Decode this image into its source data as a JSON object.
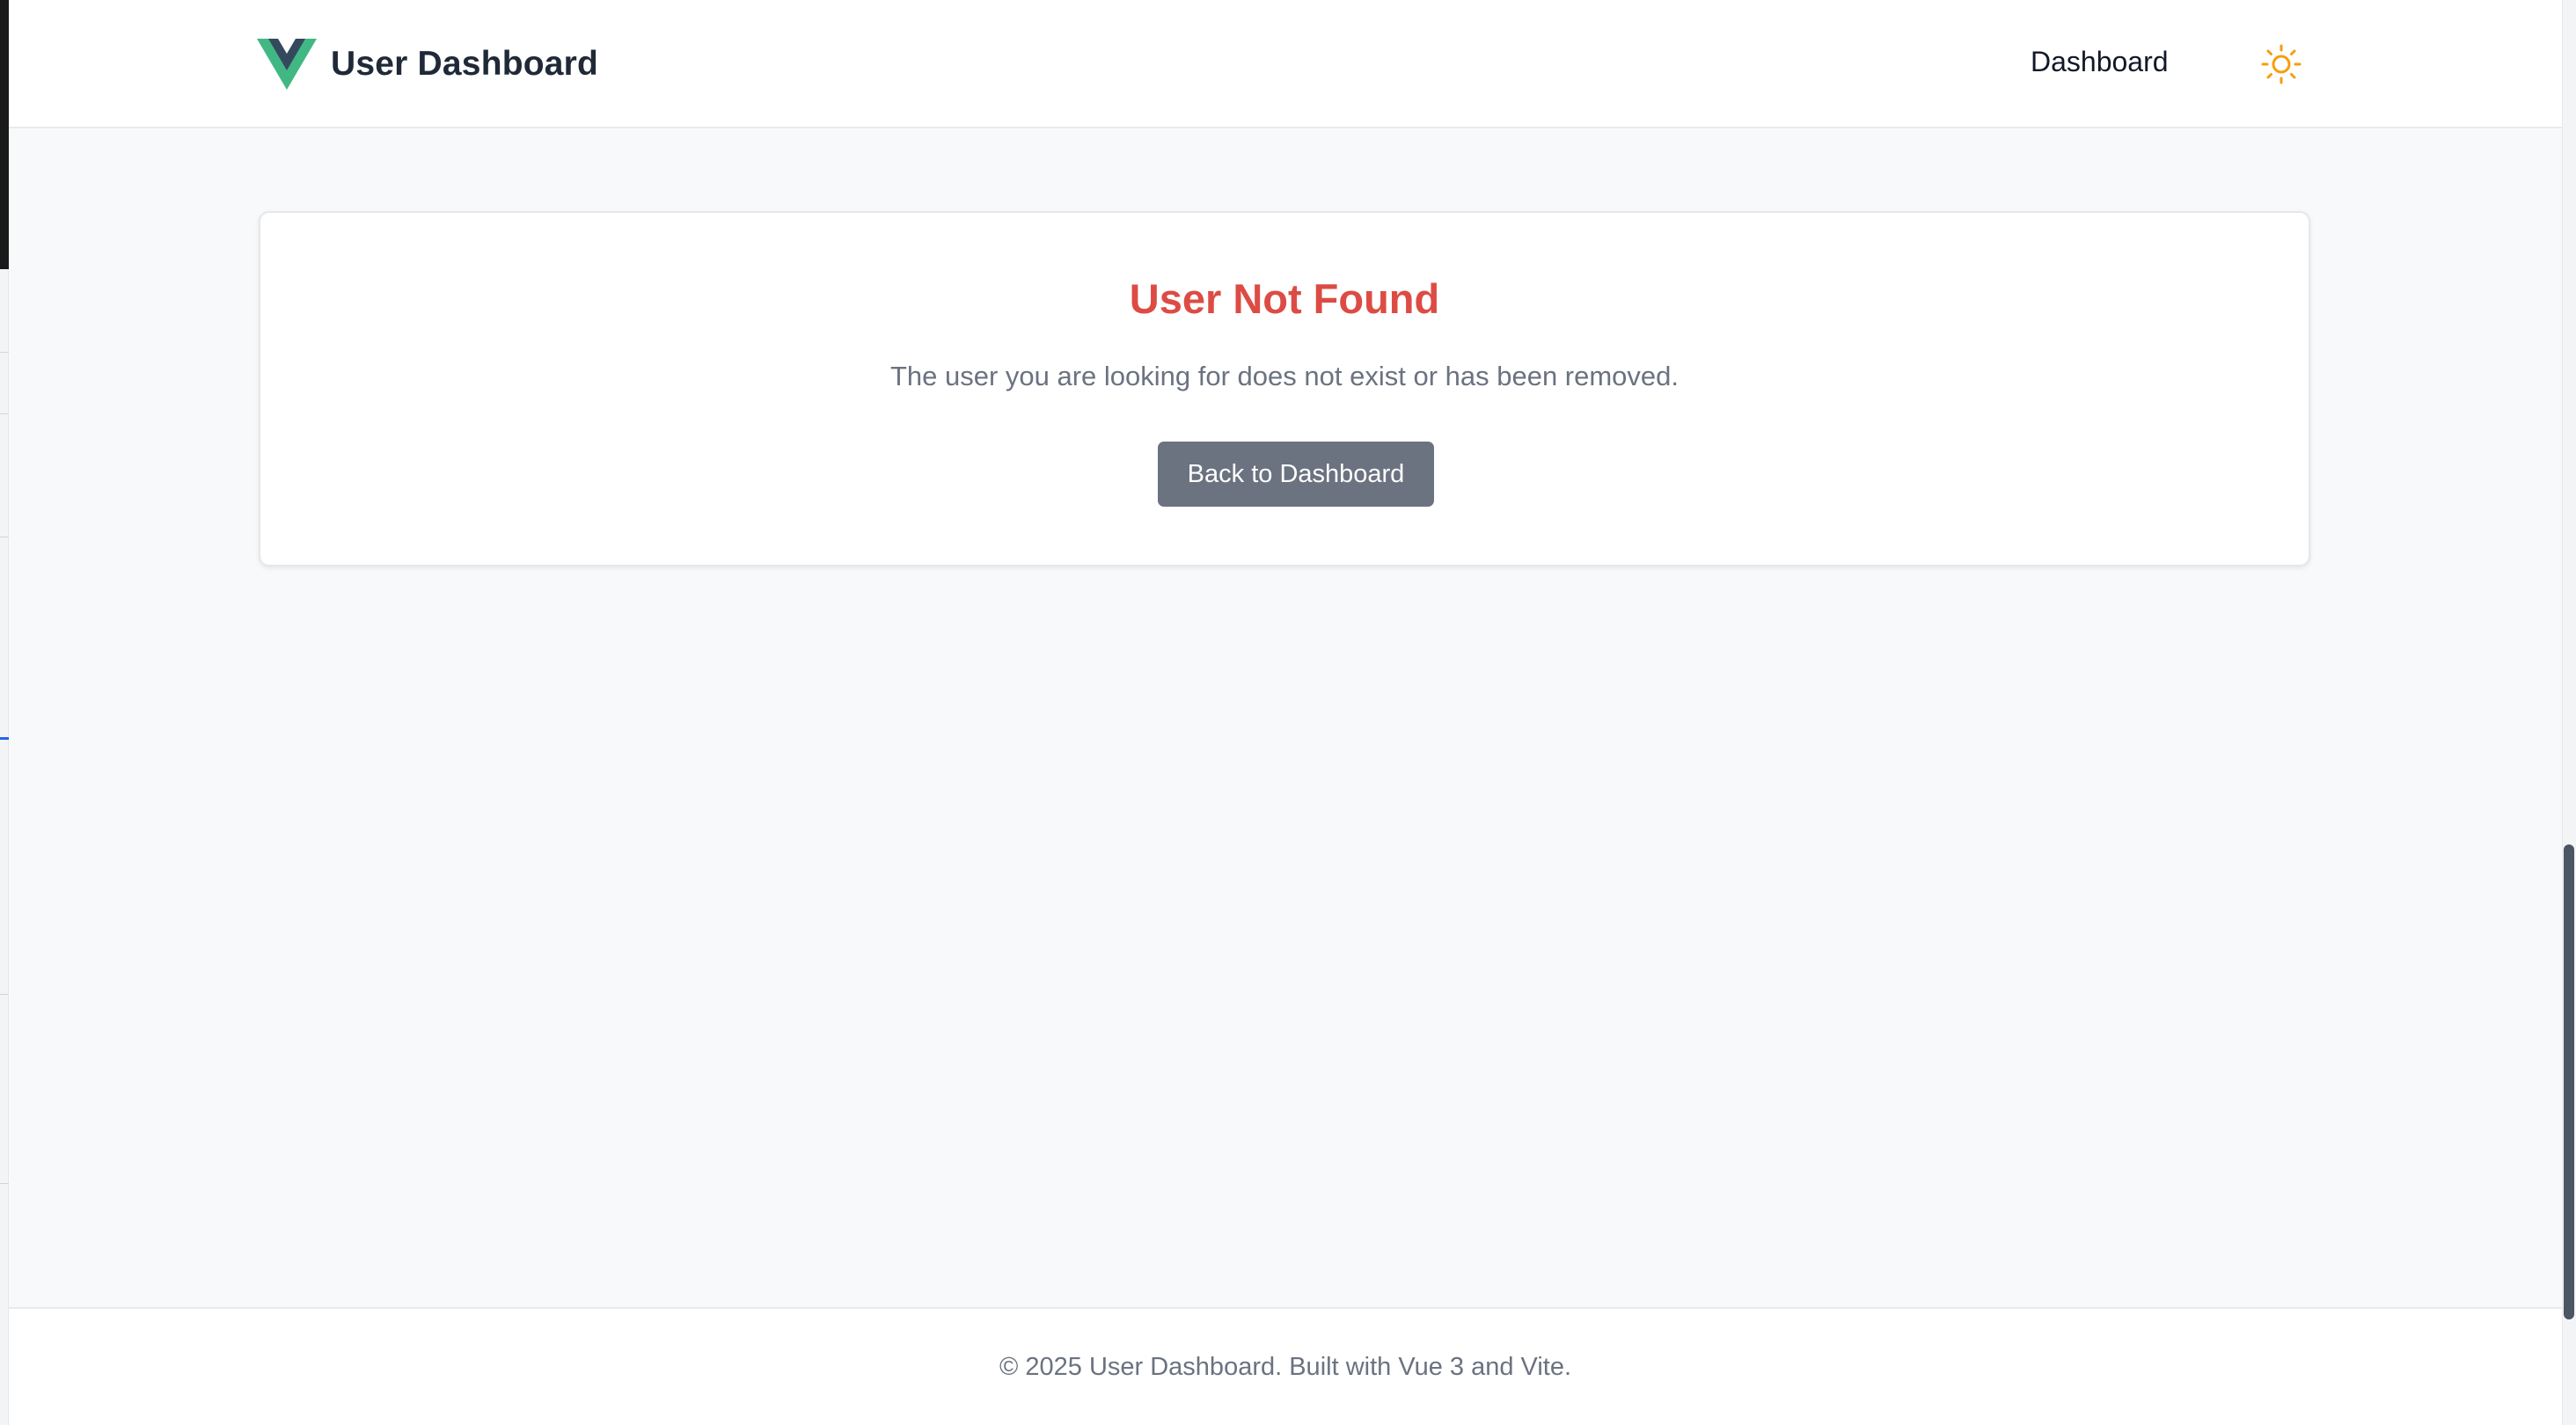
{
  "header": {
    "title": "User Dashboard",
    "logo_icon": "vue-logo-icon",
    "nav": [
      {
        "label": "Dashboard"
      }
    ],
    "theme_toggle_icon": "sun-icon"
  },
  "main": {
    "card": {
      "title": "User Not Found",
      "message": "The user you are looking for does not exist or has been removed.",
      "button_label": "Back to Dashboard"
    }
  },
  "footer": {
    "text": "© 2025 User Dashboard. Built with Vue 3 and Vite."
  },
  "colors": {
    "accent_error": "#dc4c44",
    "button_bg": "#6b7280",
    "logo_green": "#41b883",
    "logo_dark": "#35495e",
    "sun": "#f59e0b",
    "page_bg": "#f8f9fb"
  }
}
